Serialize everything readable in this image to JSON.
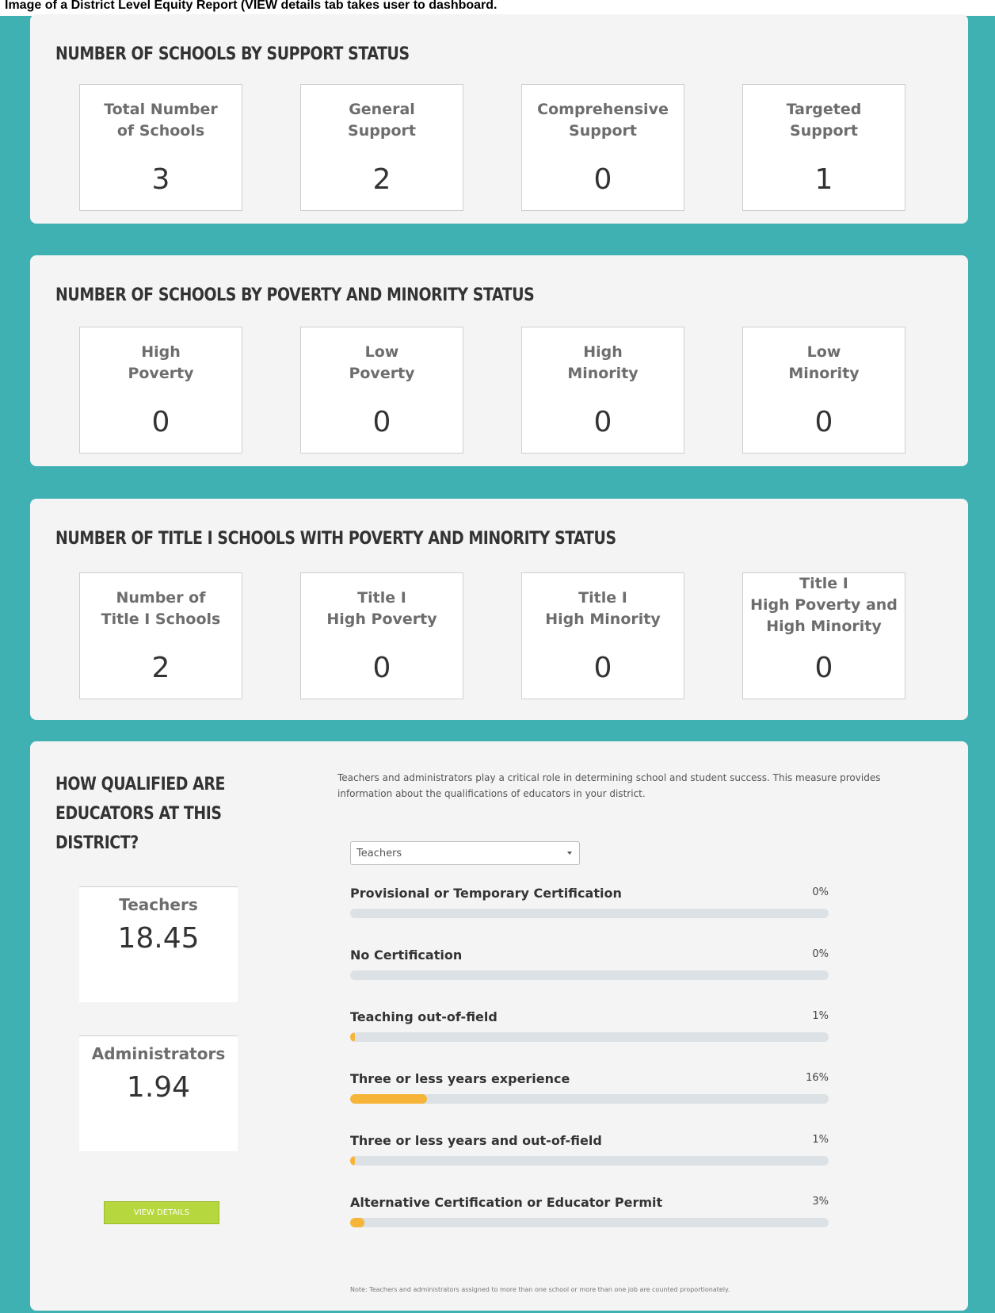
{
  "caption": "Image of a District Level Equity Report (VIEW details tab takes user to dashboard.",
  "support_status": {
    "title": "NUMBER OF SCHOOLS BY SUPPORT STATUS",
    "boxes": [
      {
        "label": "Total Number\nof Schools",
        "value": "3"
      },
      {
        "label": "General\nSupport",
        "value": "2"
      },
      {
        "label": "Comprehensive\nSupport",
        "value": "0"
      },
      {
        "label": "Targeted\nSupport",
        "value": "1"
      }
    ]
  },
  "poverty_minority": {
    "title": "NUMBER OF SCHOOLS BY POVERTY AND MINORITY STATUS",
    "boxes": [
      {
        "label": "High\nPoverty",
        "value": "0"
      },
      {
        "label": "Low\nPoverty",
        "value": "0"
      },
      {
        "label": "High\nMinority",
        "value": "0"
      },
      {
        "label": "Low\nMinority",
        "value": "0"
      }
    ]
  },
  "title_one": {
    "title": "NUMBER OF TITLE I SCHOOLS WITH POVERTY AND MINORITY STATUS",
    "boxes": [
      {
        "label": "Number of\nTitle I Schools",
        "value": "2"
      },
      {
        "label": "Title I\nHigh Poverty",
        "value": "0"
      },
      {
        "label": "Title I\nHigh Minority",
        "value": "0"
      },
      {
        "label": "Title I\nHigh Poverty and\nHigh Minority",
        "value": "0"
      }
    ]
  },
  "educators": {
    "title": "HOW QUALIFIED ARE EDUCATORS AT THIS DISTRICT?",
    "intro": "Teachers and administrators play a critical role in determining school and student success. This measure provides information about the qualifications of educators in your district.",
    "teachers": {
      "label": "Teachers",
      "value": "18.45"
    },
    "administrators": {
      "label": "Administrators",
      "value": "1.94"
    },
    "view_details_label": "VIEW DETAILS",
    "select_value": "Teachers",
    "metrics": [
      {
        "label": "Provisional or Temporary Certification",
        "pct_text": "0%",
        "pct": 0
      },
      {
        "label": "No Certification",
        "pct_text": "0%",
        "pct": 0
      },
      {
        "label": "Teaching out-of-field",
        "pct_text": "1%",
        "pct": 1
      },
      {
        "label": "Three or less years experience",
        "pct_text": "16%",
        "pct": 16
      },
      {
        "label": "Three or less years and out-of-field",
        "pct_text": "1%",
        "pct": 1
      },
      {
        "label": "Alternative Certification or Educator Permit",
        "pct_text": "3%",
        "pct": 3
      }
    ],
    "note": "Note: Teachers and administrators assigned to more than one school or more than one job are counted proportionately."
  },
  "colors": {
    "background": "#3fb1b3",
    "panel": "#f4f4f4",
    "bar_fill": "#f6b539",
    "bar_track": "#dbe1e4",
    "button": "#b6d73d"
  }
}
